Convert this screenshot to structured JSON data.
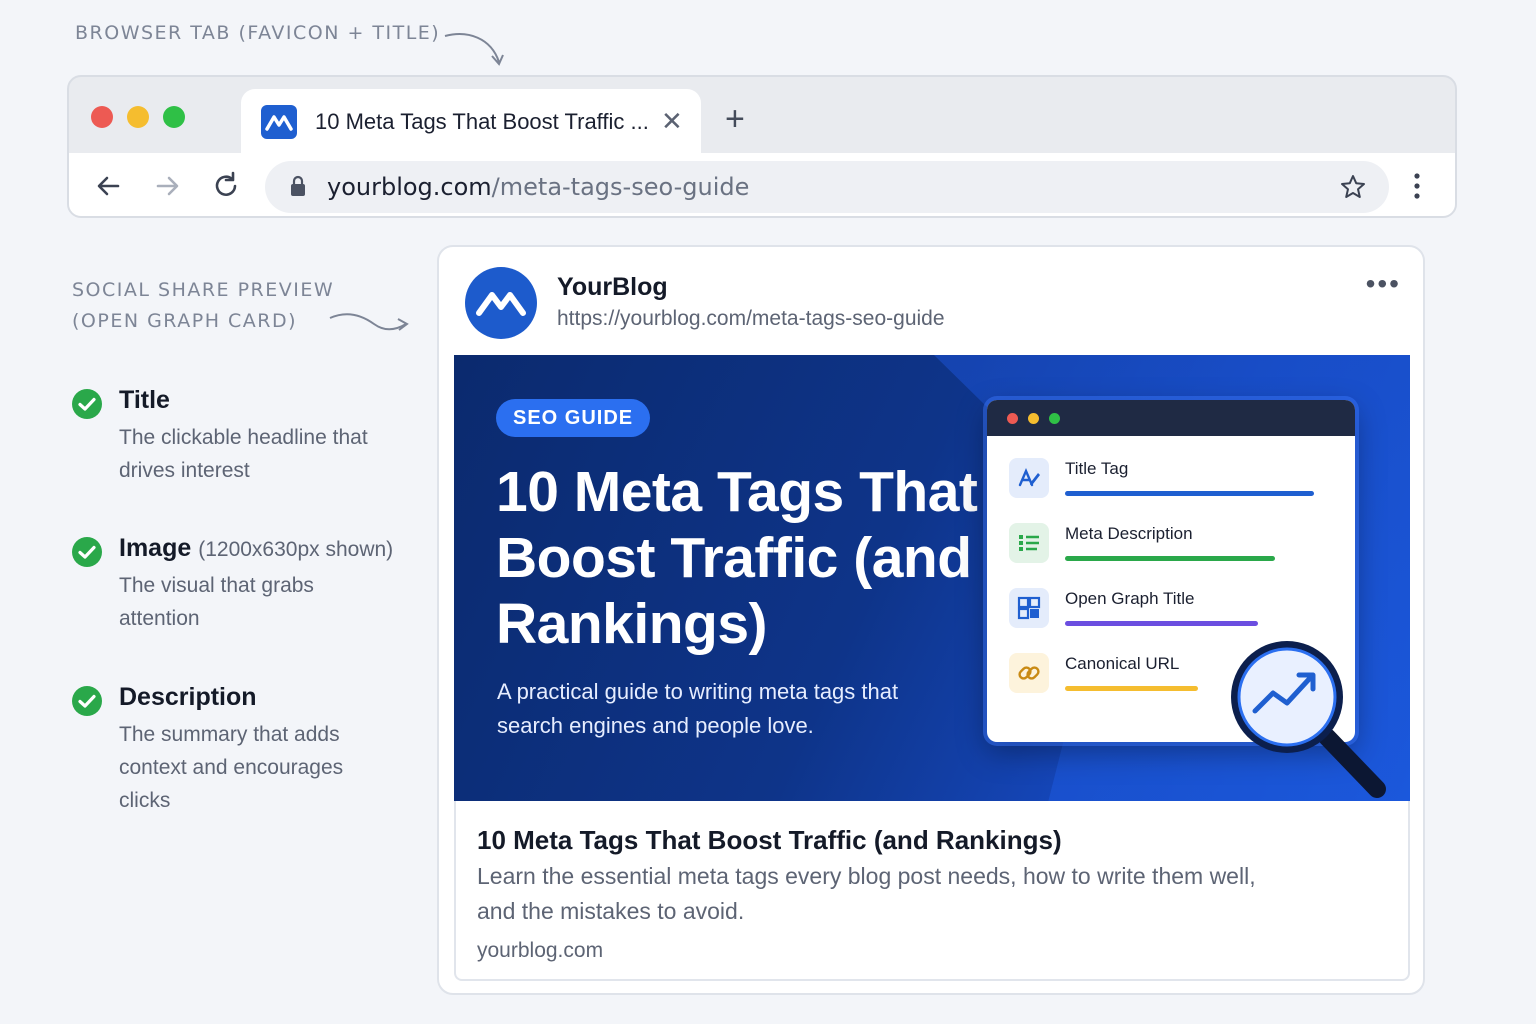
{
  "annotations": {
    "browser_tab": "BROWSER TAB (FAVICON + TITLE)",
    "social_preview_line1": "SOCIAL SHARE PREVIEW",
    "social_preview_line2": "(OPEN GRAPH CARD)"
  },
  "browser": {
    "traffic_colors": [
      "#ed5a53",
      "#f5bd2f",
      "#2fc046"
    ],
    "tab_title": "10 Meta Tags That Boost Traffic ...",
    "close_glyph": "✕",
    "new_tab_glyph": "+",
    "url_host": "yourblog.com",
    "url_path": "/meta-tags-seo-guide",
    "icons": [
      "back-arrow-icon",
      "forward-arrow-icon",
      "reload-icon",
      "lock-icon",
      "star-icon",
      "menu-dots-icon"
    ]
  },
  "notes": [
    {
      "title": "Title",
      "extra": "",
      "desc": "The clickable headline that drives interest"
    },
    {
      "title": "Image",
      "extra": "(1200x630px shown)",
      "desc": "The visual that grabs attention"
    },
    {
      "title": "Description",
      "extra": "",
      "desc": "The summary that adds context and encourages clicks"
    }
  ],
  "card": {
    "brand_name": "YourBlog",
    "brand_url": "https://yourblog.com/meta-tags-seo-guide",
    "more_glyph": "•••",
    "hero": {
      "badge": "SEO GUIDE",
      "title": "10 Meta Tags That Boost Traffic (and Rankings)",
      "subtitle": "A practical guide to writing meta tags that search engines and people love.",
      "checklist": [
        {
          "label": "Title Tag",
          "color": "#1f5fd0",
          "icon": "title-tag-icon"
        },
        {
          "label": "Meta Description",
          "color": "#2aa84a",
          "icon": "list-icon"
        },
        {
          "label": "Open Graph Title",
          "color": "#6b4ee0",
          "icon": "grid-icon"
        },
        {
          "label": "Canonical URL",
          "color": "#f5bd2f",
          "icon": "link-icon"
        }
      ]
    },
    "footer_title": "10 Meta Tags That Boost Traffic (and Rankings)",
    "footer_desc": "Learn the essential meta tags every blog post needs, how to write them well, and the mistakes to avoid.",
    "footer_domain": "yourblog.com"
  }
}
